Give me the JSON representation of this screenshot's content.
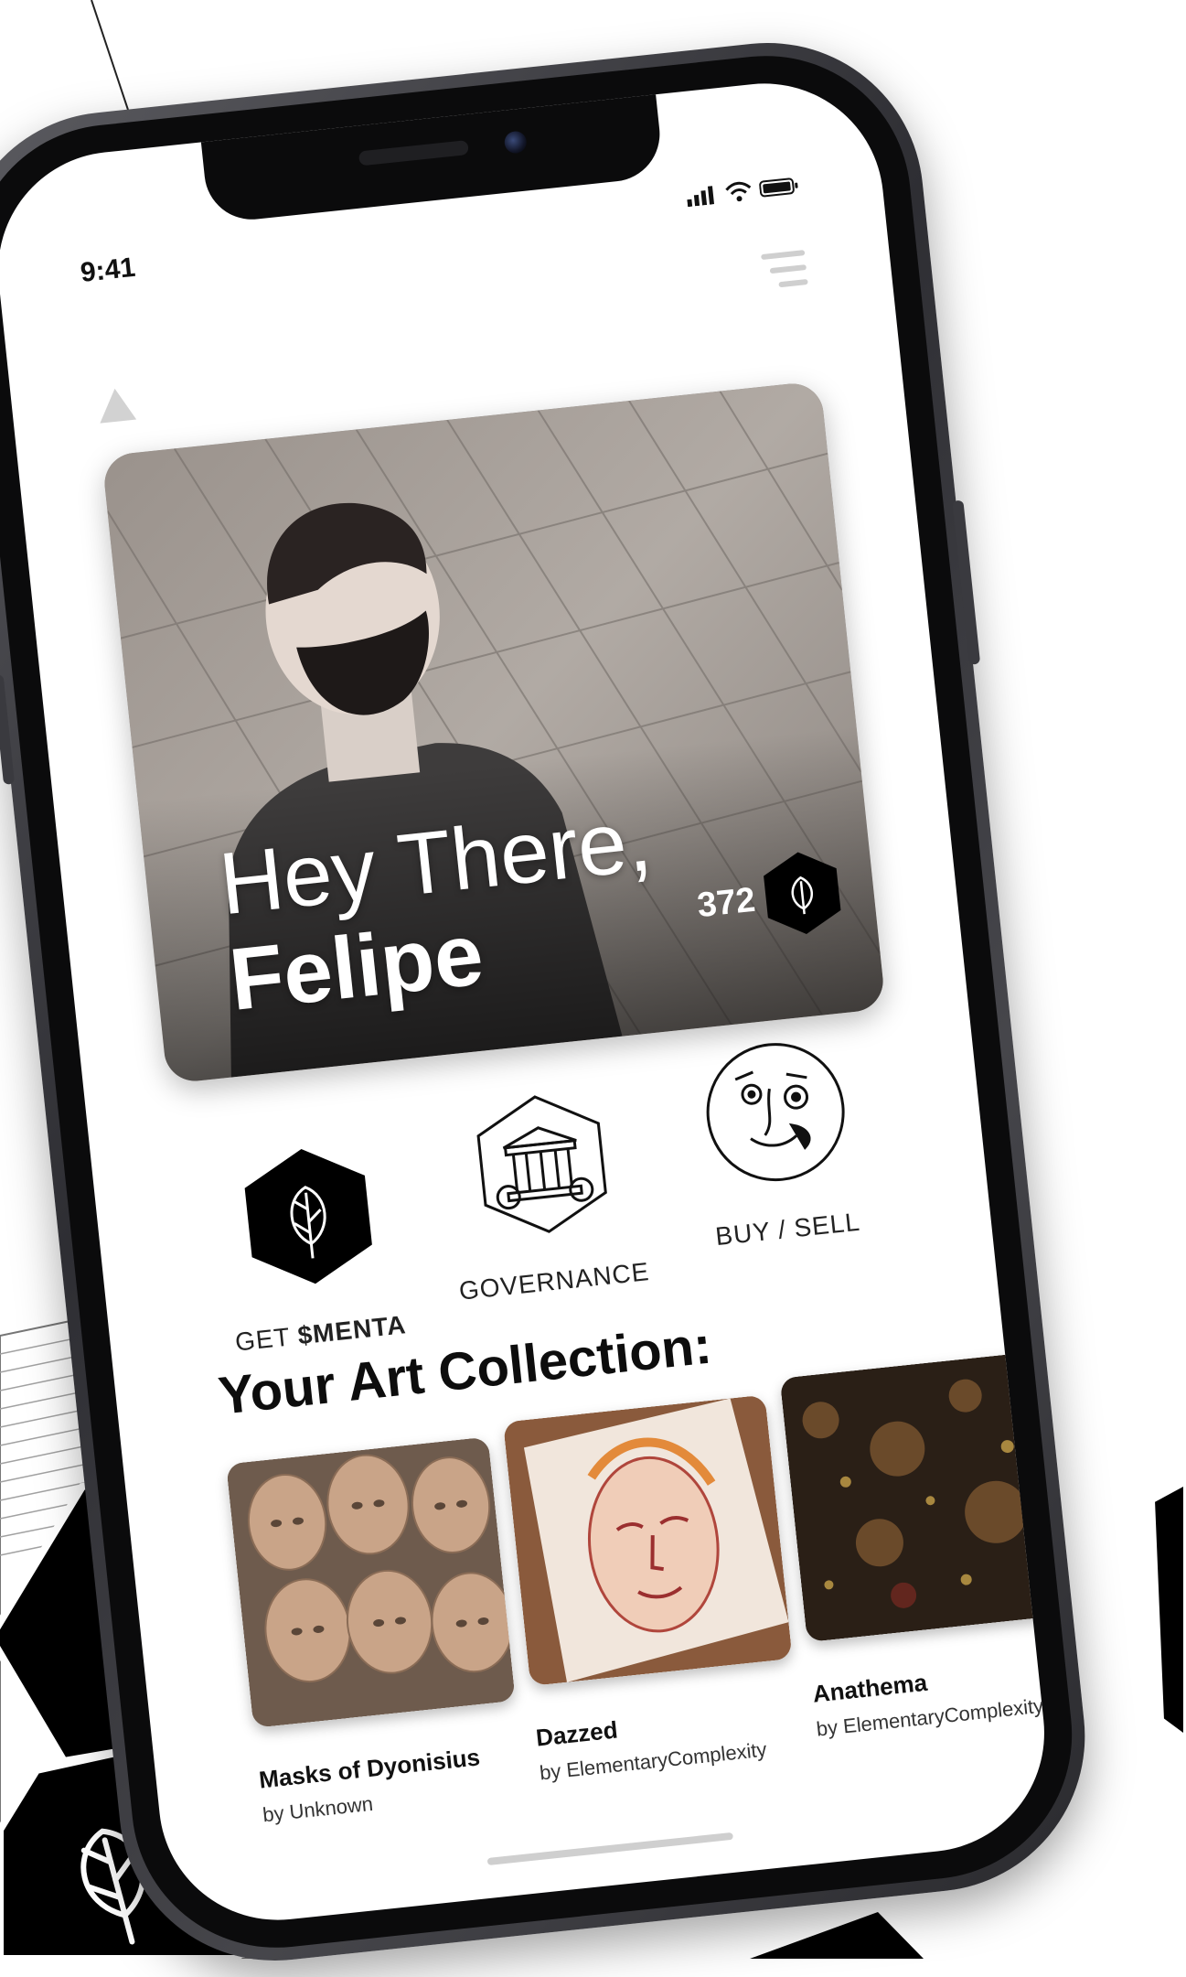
{
  "status_bar": {
    "time": "9:41"
  },
  "hero": {
    "greeting": "Hey There,",
    "name": "Felipe",
    "token_count": "372"
  },
  "actions": {
    "get_label_prefix": "GET ",
    "get_label_token": "$MENTA",
    "governance_label": "GOVERNANCE",
    "buy_sell_label": "BUY / SELL"
  },
  "collection": {
    "title": "Your Art Collection:",
    "items": [
      {
        "title": "Masks of Dyonisius",
        "artist": "by Unknown"
      },
      {
        "title": "Dazzed",
        "artist": "by ElementaryComplexity"
      },
      {
        "title": "Anathema",
        "artist": "by ElementaryComplexity"
      }
    ]
  },
  "icons": {
    "logo": "triangle-logo-icon",
    "menu": "menu-icon",
    "token": "leaf-hexagon-icon",
    "governance": "temple-hexagon-icon",
    "buy_sell": "face-art-circle-icon"
  },
  "colors": {
    "accent": "#000000",
    "screen_background": "#ffffff",
    "frame": "#3a3a3f"
  }
}
